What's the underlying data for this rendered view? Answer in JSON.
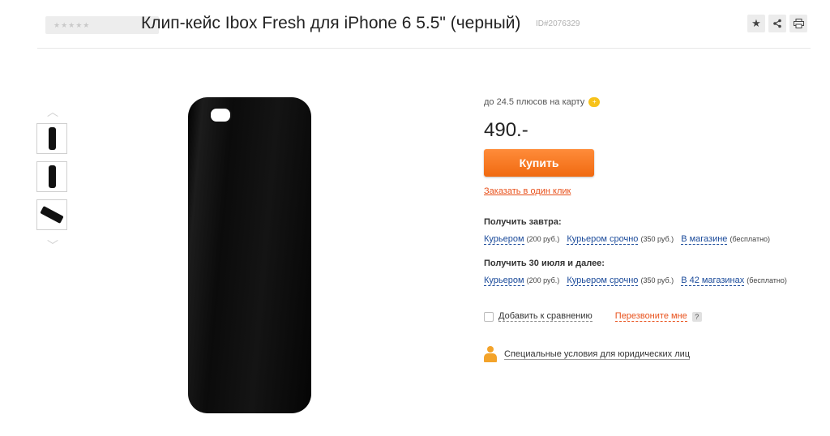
{
  "header": {
    "rating_stars": "★★★★★",
    "title": "Клип-кейс Ibox Fresh для iPhone 6 5.5\" (черный)",
    "product_id": "ID#2076329",
    "icons": [
      "star-icon",
      "share-icon",
      "print-icon"
    ]
  },
  "gallery": {
    "up_arrow": "︿",
    "down_arrow": "﹀"
  },
  "purchase": {
    "bonus_text": "до 24.5 плюсов на карту",
    "price": "490.-",
    "buy_label": "Купить",
    "one_click_label": "Заказать в один клик"
  },
  "delivery": [
    {
      "title": "Получить завтра:",
      "options": [
        {
          "label": "Курьером",
          "note": "(200 руб.)"
        },
        {
          "label": "Курьером срочно",
          "note": "(350 руб.)"
        },
        {
          "label": "В магазине",
          "note": "(бесплатно)"
        }
      ]
    },
    {
      "title": "Получить 30 июля и далее:",
      "options": [
        {
          "label": "Курьером",
          "note": "(200 руб.)"
        },
        {
          "label": "Курьером срочно",
          "note": "(350 руб.)"
        },
        {
          "label": "В 42 магазинах",
          "note": "(бесплатно)"
        }
      ]
    }
  ],
  "extras": {
    "compare_label": "Добавить к сравнению",
    "callback_label": "Перезвоните мне",
    "help_symbol": "?"
  },
  "legal": {
    "label": "Специальные условия для юридических лиц"
  },
  "colors": {
    "accent_orange": "#f06a10",
    "link_blue": "#1a4a9a"
  }
}
